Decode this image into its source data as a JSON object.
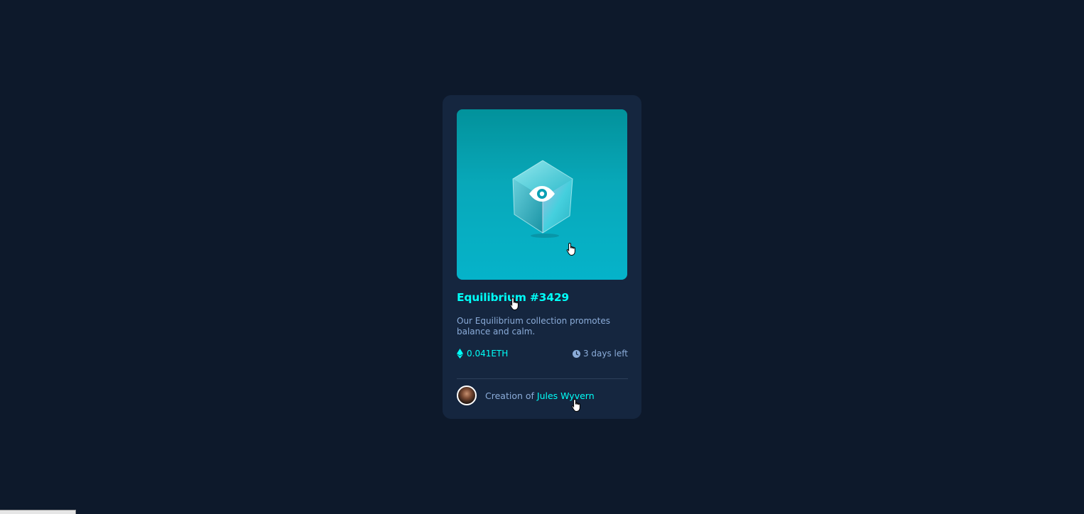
{
  "card": {
    "title": "Equilibrium #3429",
    "description": "Our Equilibrium collection promotes balance and calm.",
    "price": "0.041ETH",
    "time_left": "3 days left",
    "creator_prefix": "Creation of",
    "creator_name": "Jules Wyvern"
  },
  "icons": {
    "view": "eye-icon",
    "price": "ethereum-icon",
    "time": "clock-icon",
    "cursor": "hand-cursor-icon"
  },
  "colors": {
    "background": "#0d192b",
    "card": "#15263f",
    "accent": "#00fff8",
    "muted": "#8bacd9",
    "divider": "#2e405a"
  }
}
